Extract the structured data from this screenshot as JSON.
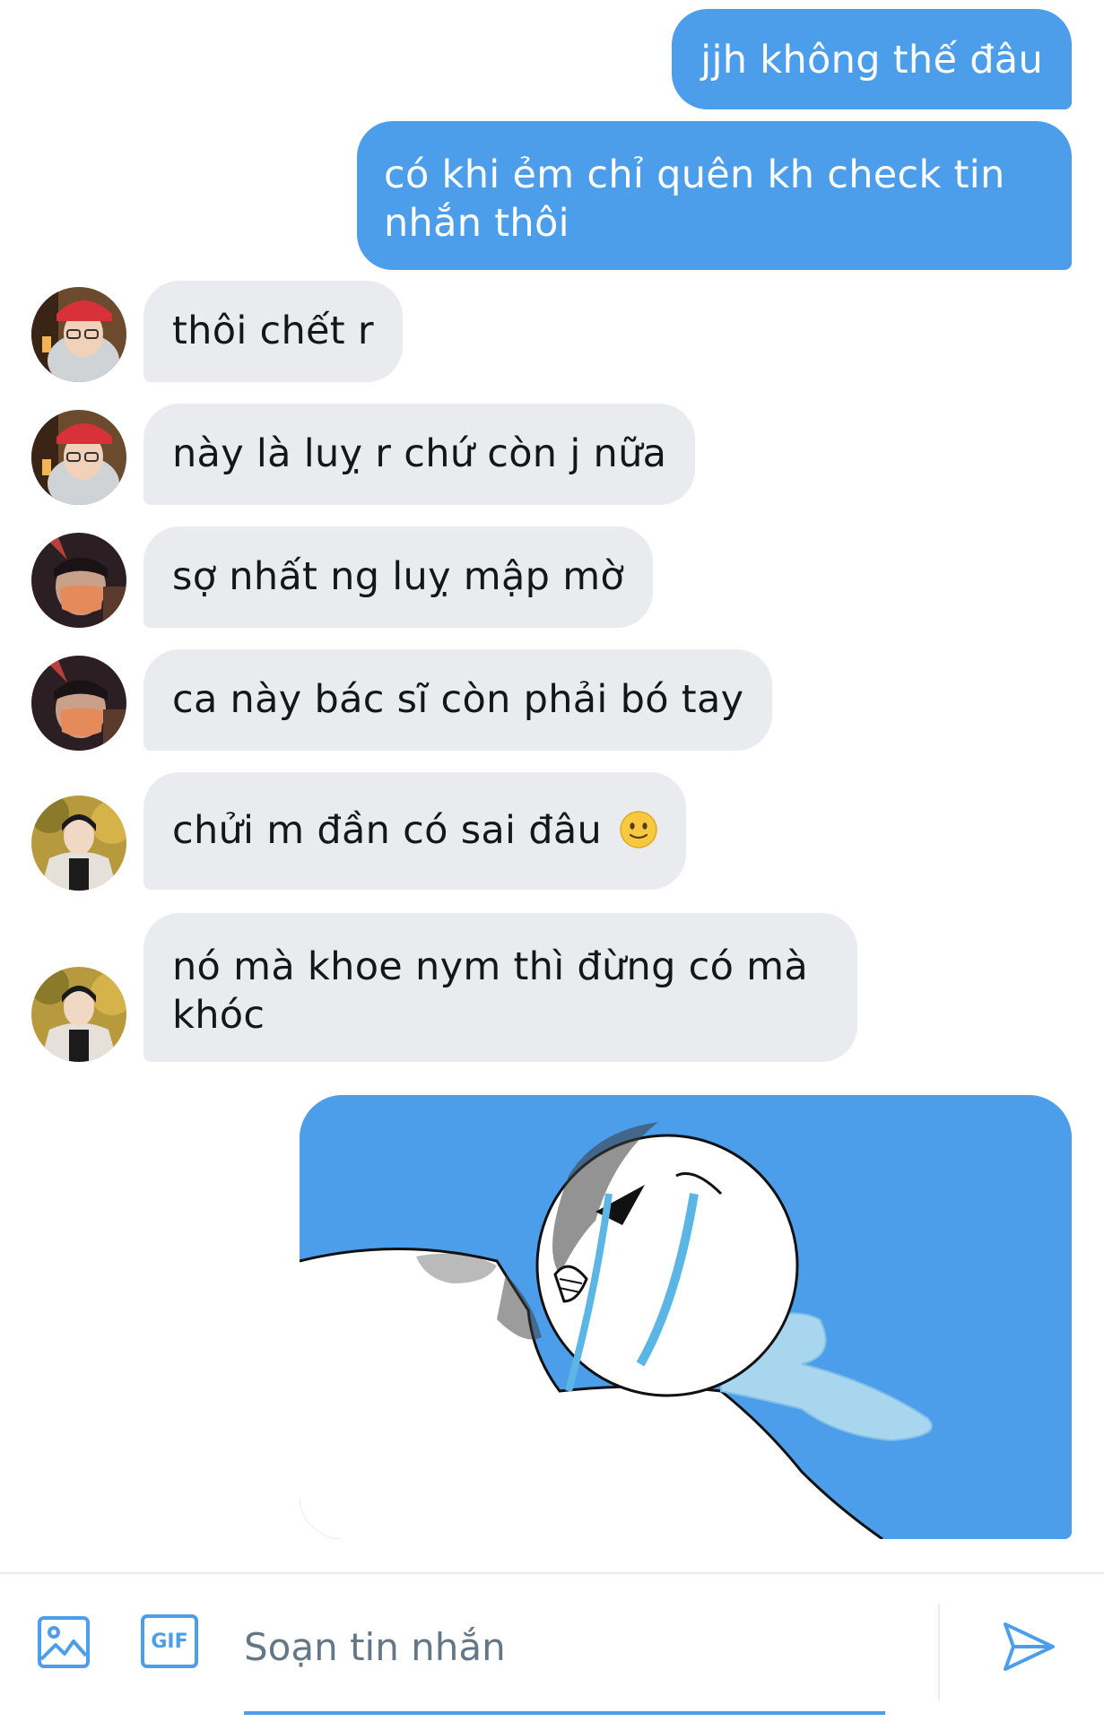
{
  "messages": [
    {
      "direction": "out",
      "text": "jjh không thế đâu"
    },
    {
      "direction": "out",
      "text": "có khi ẻm chỉ quên kh check tin nhắn thôi"
    },
    {
      "direction": "in",
      "sender_avatar": "avatar-red-cap",
      "text": "thôi chết r"
    },
    {
      "direction": "in",
      "sender_avatar": "avatar-red-cap",
      "text": "này là luỵ r chứ còn j nữa"
    },
    {
      "direction": "in",
      "sender_avatar": "avatar-mask",
      "text": "sợ nhất ng luỵ mập mờ"
    },
    {
      "direction": "in",
      "sender_avatar": "avatar-mask",
      "text": "ca này bác sĩ còn phải bó tay"
    },
    {
      "direction": "in",
      "sender_avatar": "avatar-jacket",
      "text": "chửi m đần có sai đâu",
      "emoji": "slightly-smiling-face"
    },
    {
      "direction": "in",
      "sender_avatar": "avatar-jacket",
      "text": "nó mà khoe nym thì đừng có mà khóc"
    },
    {
      "direction": "out",
      "type": "image",
      "image": "crying-meme-sticker"
    }
  ],
  "composer": {
    "placeholder": "Soạn tin nhắn",
    "value": "",
    "icons": [
      "image-icon",
      "gif-icon",
      "send-icon"
    ],
    "gif_label": "GIF"
  },
  "colors": {
    "outgoing_bubble": "#4c9eeb",
    "incoming_bubble": "#e9ebef",
    "accent": "#4c9eeb",
    "text": "#14171a",
    "placeholder": "#657786"
  }
}
